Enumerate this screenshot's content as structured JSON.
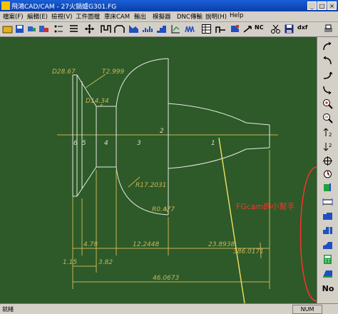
{
  "window": {
    "title": "飛鴻CAD/CAM - 27火鍋爐G301.FG"
  },
  "menu": [
    "檔案(F)",
    "編輯(E)",
    "檢視(V)",
    "工件圖檔",
    "車床CAM",
    "輸出",
    "模擬器",
    "DNC傳輸",
    "說明(H)",
    "Help"
  ],
  "toolbar": {
    "nc_label": "NC",
    "dxf_label": "dxf"
  },
  "rightbar": {
    "no_label": "No"
  },
  "drawing": {
    "labels": {
      "d_outer": "D28.67",
      "t_wall": "T2.999",
      "d_neck": "D14.34",
      "radius": "R17.2031",
      "r_small": "R0.477",
      "seg_1": "1",
      "seg_2": "2",
      "seg_3": "3",
      "seg_4": "4",
      "seg_5": "5",
      "seg_6": "6"
    },
    "dims": {
      "d_478": "4.78",
      "d_122": "12.2448",
      "d_238": "23.8938",
      "d_386": "386.0171",
      "d_115": "1.15",
      "d_382": "3.82",
      "d_460": "46.0673"
    },
    "annotation": "FGcam的小幫手"
  },
  "status": {
    "left": "就緒",
    "num": "NUM"
  }
}
